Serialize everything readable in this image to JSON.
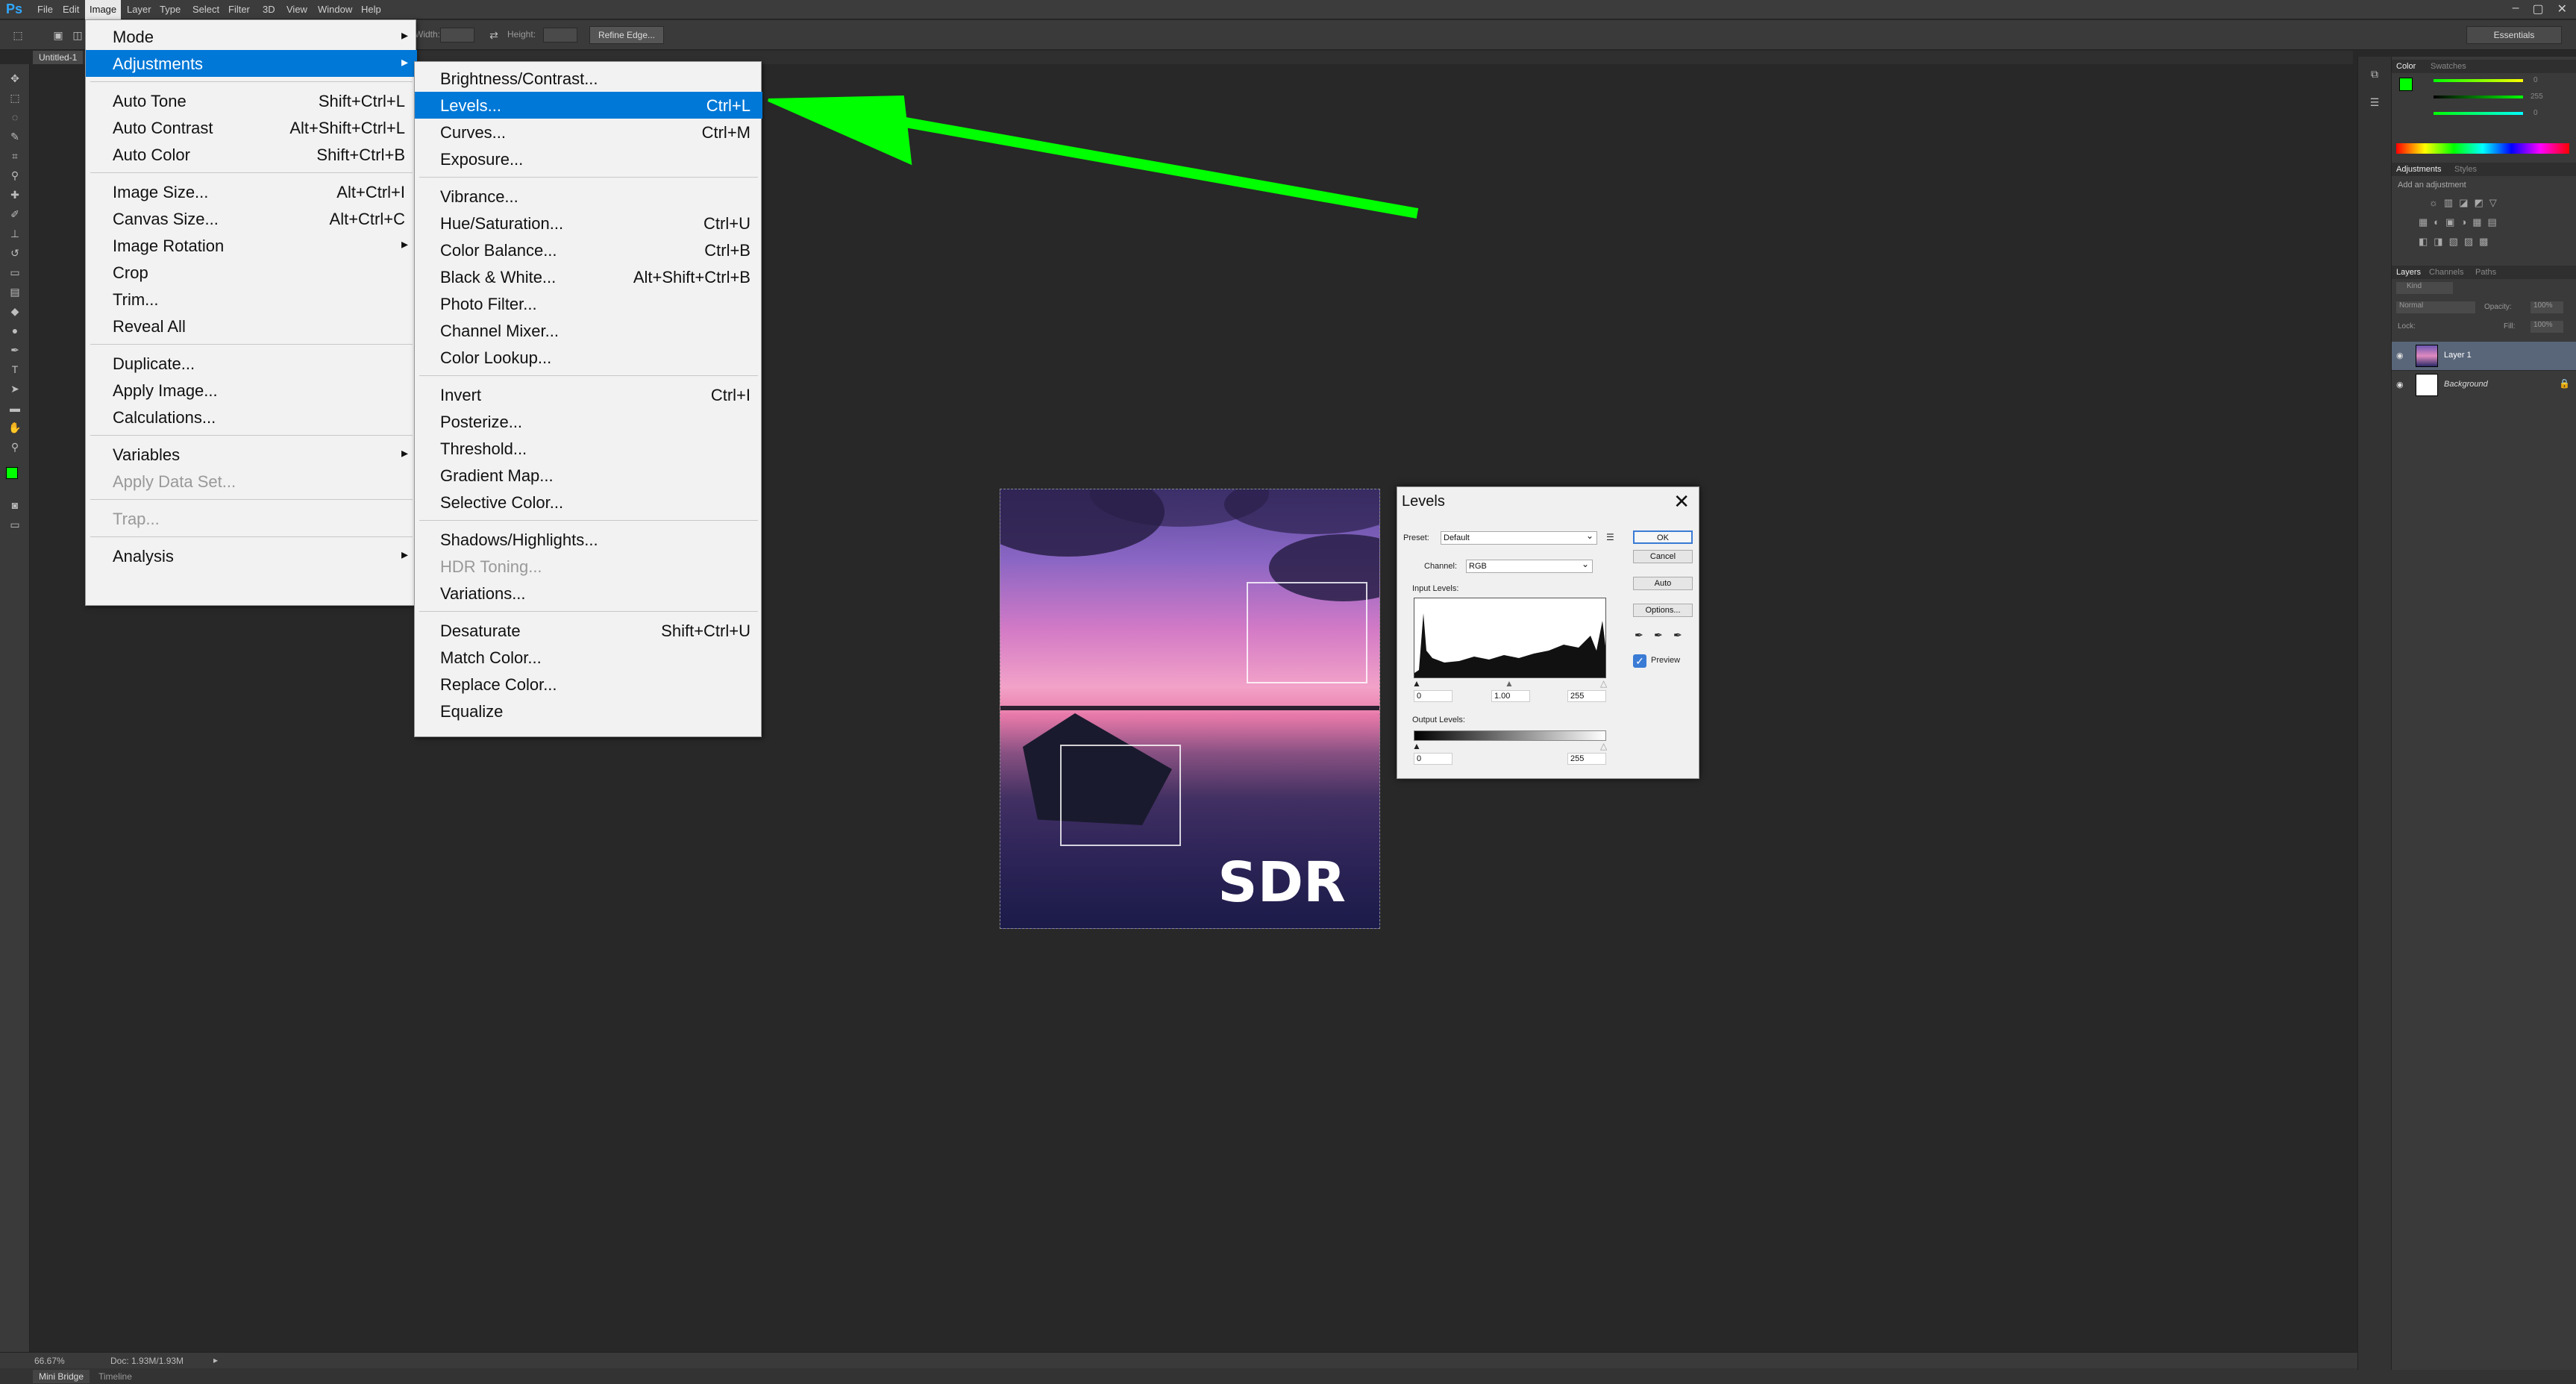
{
  "app": {
    "menubar": [
      "File",
      "Edit",
      "Image",
      "Layer",
      "Type",
      "Select",
      "Filter",
      "3D",
      "View",
      "Window",
      "Help"
    ],
    "active_menu": "Image",
    "workspace": "Essentials"
  },
  "options_bar": {
    "width_label": "Width:",
    "height_label": "Height:",
    "refine_edge": "Refine Edge..."
  },
  "document": {
    "tab_title": "Untitled-1",
    "zoom": "66.67%",
    "doc_info": "Doc: 1.93M/1.93M",
    "image_label": "SDR"
  },
  "bottom_tabs": [
    "Mini Bridge",
    "Timeline"
  ],
  "image_menu": {
    "items": [
      {
        "label": "Mode",
        "shortcut": "",
        "submenu": true,
        "disabled": false,
        "highlighted": false
      },
      {
        "label": "Adjustments",
        "shortcut": "",
        "submenu": true,
        "disabled": false,
        "highlighted": true
      },
      {
        "label": "Auto Tone",
        "shortcut": "Shift+Ctrl+L",
        "submenu": false,
        "disabled": false,
        "highlighted": false
      },
      {
        "label": "Auto Contrast",
        "shortcut": "Alt+Shift+Ctrl+L",
        "submenu": false,
        "disabled": false,
        "highlighted": false
      },
      {
        "label": "Auto Color",
        "shortcut": "Shift+Ctrl+B",
        "submenu": false,
        "disabled": false,
        "highlighted": false
      },
      {
        "label": "Image Size...",
        "shortcut": "Alt+Ctrl+I",
        "submenu": false,
        "disabled": false,
        "highlighted": false
      },
      {
        "label": "Canvas Size...",
        "shortcut": "Alt+Ctrl+C",
        "submenu": false,
        "disabled": false,
        "highlighted": false
      },
      {
        "label": "Image Rotation",
        "shortcut": "",
        "submenu": true,
        "disabled": false,
        "highlighted": false
      },
      {
        "label": "Crop",
        "shortcut": "",
        "submenu": false,
        "disabled": false,
        "highlighted": false
      },
      {
        "label": "Trim...",
        "shortcut": "",
        "submenu": false,
        "disabled": false,
        "highlighted": false
      },
      {
        "label": "Reveal All",
        "shortcut": "",
        "submenu": false,
        "disabled": false,
        "highlighted": false
      },
      {
        "label": "Duplicate...",
        "shortcut": "",
        "submenu": false,
        "disabled": false,
        "highlighted": false
      },
      {
        "label": "Apply Image...",
        "shortcut": "",
        "submenu": false,
        "disabled": false,
        "highlighted": false
      },
      {
        "label": "Calculations...",
        "shortcut": "",
        "submenu": false,
        "disabled": false,
        "highlighted": false
      },
      {
        "label": "Variables",
        "shortcut": "",
        "submenu": true,
        "disabled": false,
        "highlighted": false
      },
      {
        "label": "Apply Data Set...",
        "shortcut": "",
        "submenu": false,
        "disabled": true,
        "highlighted": false
      },
      {
        "label": "Trap...",
        "shortcut": "",
        "submenu": false,
        "disabled": true,
        "highlighted": false
      },
      {
        "label": "Analysis",
        "shortcut": "",
        "submenu": true,
        "disabled": false,
        "highlighted": false
      }
    ]
  },
  "adjustments_menu": {
    "items": [
      {
        "label": "Brightness/Contrast...",
        "shortcut": "",
        "disabled": false,
        "highlighted": false
      },
      {
        "label": "Levels...",
        "shortcut": "Ctrl+L",
        "disabled": false,
        "highlighted": true
      },
      {
        "label": "Curves...",
        "shortcut": "Ctrl+M",
        "disabled": false,
        "highlighted": false
      },
      {
        "label": "Exposure...",
        "shortcut": "",
        "disabled": false,
        "highlighted": false
      },
      {
        "label": "Vibrance...",
        "shortcut": "",
        "disabled": false,
        "highlighted": false
      },
      {
        "label": "Hue/Saturation...",
        "shortcut": "Ctrl+U",
        "disabled": false,
        "highlighted": false
      },
      {
        "label": "Color Balance...",
        "shortcut": "Ctrl+B",
        "disabled": false,
        "highlighted": false
      },
      {
        "label": "Black & White...",
        "shortcut": "Alt+Shift+Ctrl+B",
        "disabled": false,
        "highlighted": false
      },
      {
        "label": "Photo Filter...",
        "shortcut": "",
        "disabled": false,
        "highlighted": false
      },
      {
        "label": "Channel Mixer...",
        "shortcut": "",
        "disabled": false,
        "highlighted": false
      },
      {
        "label": "Color Lookup...",
        "shortcut": "",
        "disabled": false,
        "highlighted": false
      },
      {
        "label": "Invert",
        "shortcut": "Ctrl+I",
        "disabled": false,
        "highlighted": false
      },
      {
        "label": "Posterize...",
        "shortcut": "",
        "disabled": false,
        "highlighted": false
      },
      {
        "label": "Threshold...",
        "shortcut": "",
        "disabled": false,
        "highlighted": false
      },
      {
        "label": "Gradient Map...",
        "shortcut": "",
        "disabled": false,
        "highlighted": false
      },
      {
        "label": "Selective Color...",
        "shortcut": "",
        "disabled": false,
        "highlighted": false
      },
      {
        "label": "Shadows/Highlights...",
        "shortcut": "",
        "disabled": false,
        "highlighted": false
      },
      {
        "label": "HDR Toning...",
        "shortcut": "",
        "disabled": true,
        "highlighted": false
      },
      {
        "label": "Variations...",
        "shortcut": "",
        "disabled": false,
        "highlighted": false
      },
      {
        "label": "Desaturate",
        "shortcut": "Shift+Ctrl+U",
        "disabled": false,
        "highlighted": false
      },
      {
        "label": "Match Color...",
        "shortcut": "",
        "disabled": false,
        "highlighted": false
      },
      {
        "label": "Replace Color...",
        "shortcut": "",
        "disabled": false,
        "highlighted": false
      },
      {
        "label": "Equalize",
        "shortcut": "",
        "disabled": false,
        "highlighted": false
      }
    ]
  },
  "levels_dialog": {
    "title": "Levels",
    "preset_label": "Preset:",
    "preset_value": "Default",
    "channel_label": "Channel:",
    "channel_value": "RGB",
    "input_levels_label": "Input Levels:",
    "output_levels_label": "Output Levels:",
    "input_black": "0",
    "input_gamma": "1.00",
    "input_white": "255",
    "output_black": "0",
    "output_white": "255",
    "ok": "OK",
    "cancel": "Cancel",
    "auto": "Auto",
    "options": "Options...",
    "preview_label": "Preview",
    "preview_checked": true
  },
  "panels": {
    "color_tabs": [
      "Color",
      "Swatches"
    ],
    "color_values": {
      "R": "0",
      "G": "255",
      "B": "0"
    },
    "adjustments_tabs": [
      "Adjustments",
      "Styles"
    ],
    "adjustments_hint": "Add an adjustment",
    "layers_tabs": [
      "Layers",
      "Channels",
      "Paths"
    ],
    "layers_kind": "Kind",
    "blend_mode": "Normal",
    "opacity_label": "Opacity:",
    "opacity_value": "100%",
    "lock_label": "Lock:",
    "fill_label": "Fill:",
    "fill_value": "100%",
    "layers": [
      "Layer 1",
      "Background"
    ]
  },
  "colors": {
    "menu_highlight": "#0078d7",
    "annotation_arrow": "#00ff00",
    "fg_swatch": "#00ff00"
  }
}
